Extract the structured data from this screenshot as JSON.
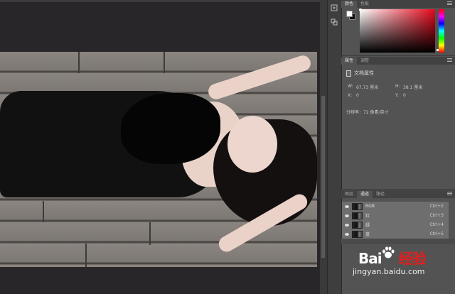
{
  "color_panel": {
    "tabs": [
      {
        "label": "颜色"
      },
      {
        "label": "色板"
      }
    ]
  },
  "properties_panel": {
    "tabs": [
      {
        "label": "属性"
      },
      {
        "label": "调整"
      }
    ],
    "title": "文档属性",
    "w_label": "W:",
    "w_value": "67.73 厘米",
    "h_label": "H:",
    "h_value": "38.1 厘米",
    "x_label": "X:",
    "x_value": "0",
    "y_label": "Y:",
    "y_value": "0",
    "resolution": "分辨率：72 像素/英寸"
  },
  "channels_panel": {
    "tabs": [
      {
        "label": "图层"
      },
      {
        "label": "通道"
      },
      {
        "label": "路径"
      }
    ],
    "channels": [
      {
        "name": "RGB",
        "shortcut": "Ctrl+2"
      },
      {
        "name": "红",
        "shortcut": "Ctrl+3"
      },
      {
        "name": "绿",
        "shortcut": "Ctrl+4"
      },
      {
        "name": "蓝",
        "shortcut": "Ctrl+5"
      }
    ]
  },
  "watermark": {
    "brand_left": "Bai",
    "brand_right": "经验",
    "site": "jingyan.baidu.com"
  },
  "colors": {
    "foreground": "#ffffff",
    "background": "#111111",
    "accent_red": "#e8081c"
  }
}
